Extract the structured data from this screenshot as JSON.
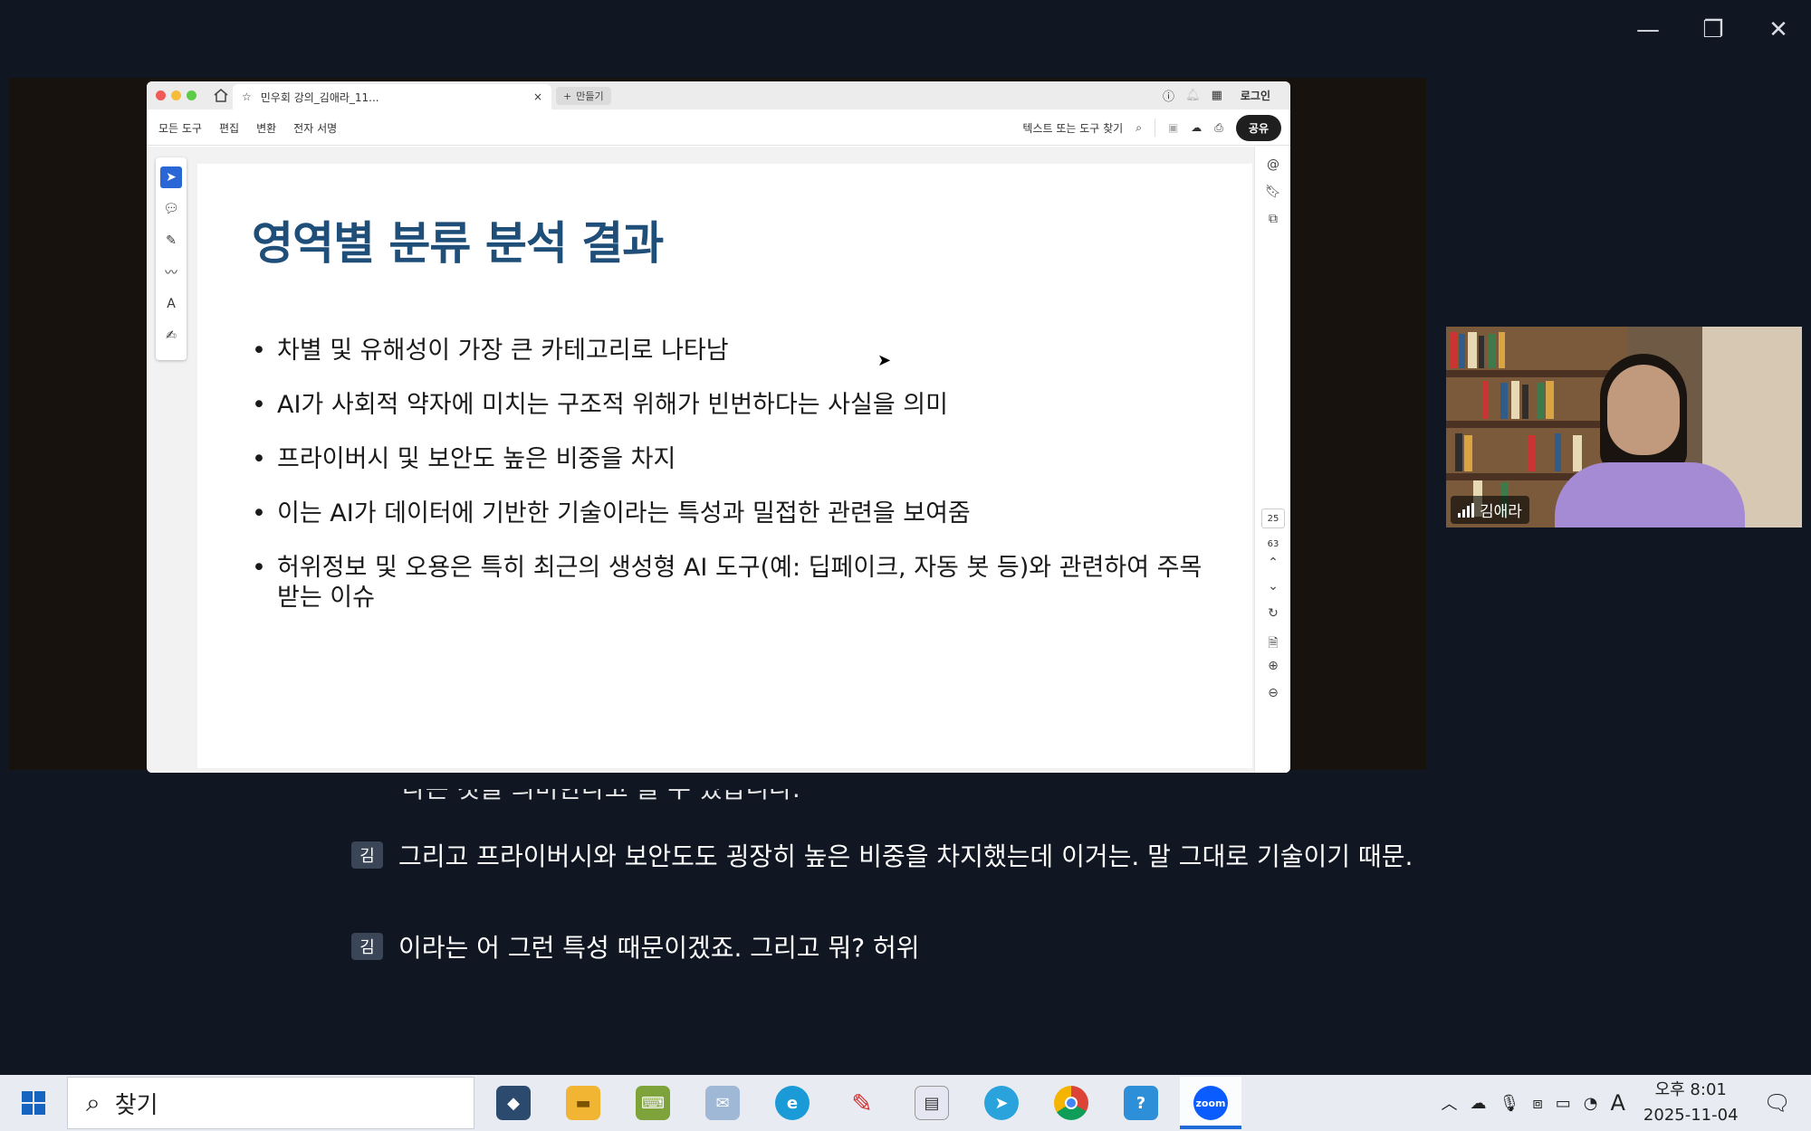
{
  "window": {
    "minimize": "—",
    "restore": "❐",
    "close": "✕"
  },
  "browser": {
    "tab_title": "민우회 강의_김애라_11...",
    "tab_close": "×",
    "new_tab_label": "만들기",
    "login_label": "로그인"
  },
  "acrobat": {
    "menu": [
      "모든 도구",
      "편집",
      "변환",
      "전자 서명"
    ],
    "search_label": "텍스트 또는 도구 찾기",
    "share_label": "공유",
    "page_current": "25",
    "page_total": "63"
  },
  "slide": {
    "title": "영역별 분류 분석 결과",
    "bullets": [
      "차별 및 유해성이 가장 큰 카테고리로 나타남",
      "AI가 사회적 약자에 미치는 구조적 위해가 빈번하다는 사실을 의미",
      "프라이버시 및 보안도 높은 비중을 차지",
      "이는 AI가 데이터에 기반한 기술이라는 특성과 밀접한 관련을 보여줌",
      "허위정보 및 오용은 특히 최근의 생성형 AI 도구(예: 딥페이크, 자동 봇 등)와 관련하여 주목받는 이슈"
    ]
  },
  "video": {
    "participant_name": "김애라"
  },
  "captions": {
    "partial_line": "다는 것을 의미한다고 볼 수 있습니다.",
    "items": [
      {
        "avatar": "김",
        "text": "그리고 프라이버시와 보안도도 굉장히 높은 비중을 차지했는데 이거는. 말 그대로 기술이기 때문."
      },
      {
        "avatar": "김",
        "text": "이라는 어 그런 특성 때문이겠죠. 그리고 뭐? 허위"
      }
    ]
  },
  "taskbar": {
    "search_placeholder": "찾기",
    "apps": [
      "widgets-app",
      "file-explorer",
      "keyboard-app",
      "notepad-app",
      "edge-browser",
      "pen-app",
      "calendar-app",
      "telegram-app",
      "chrome-browser",
      "help-app",
      "zoom-app"
    ],
    "zoom_label": "zoom",
    "clock_time": "오후 8:01",
    "clock_date": "2025-11-04",
    "ime_label": "A"
  }
}
